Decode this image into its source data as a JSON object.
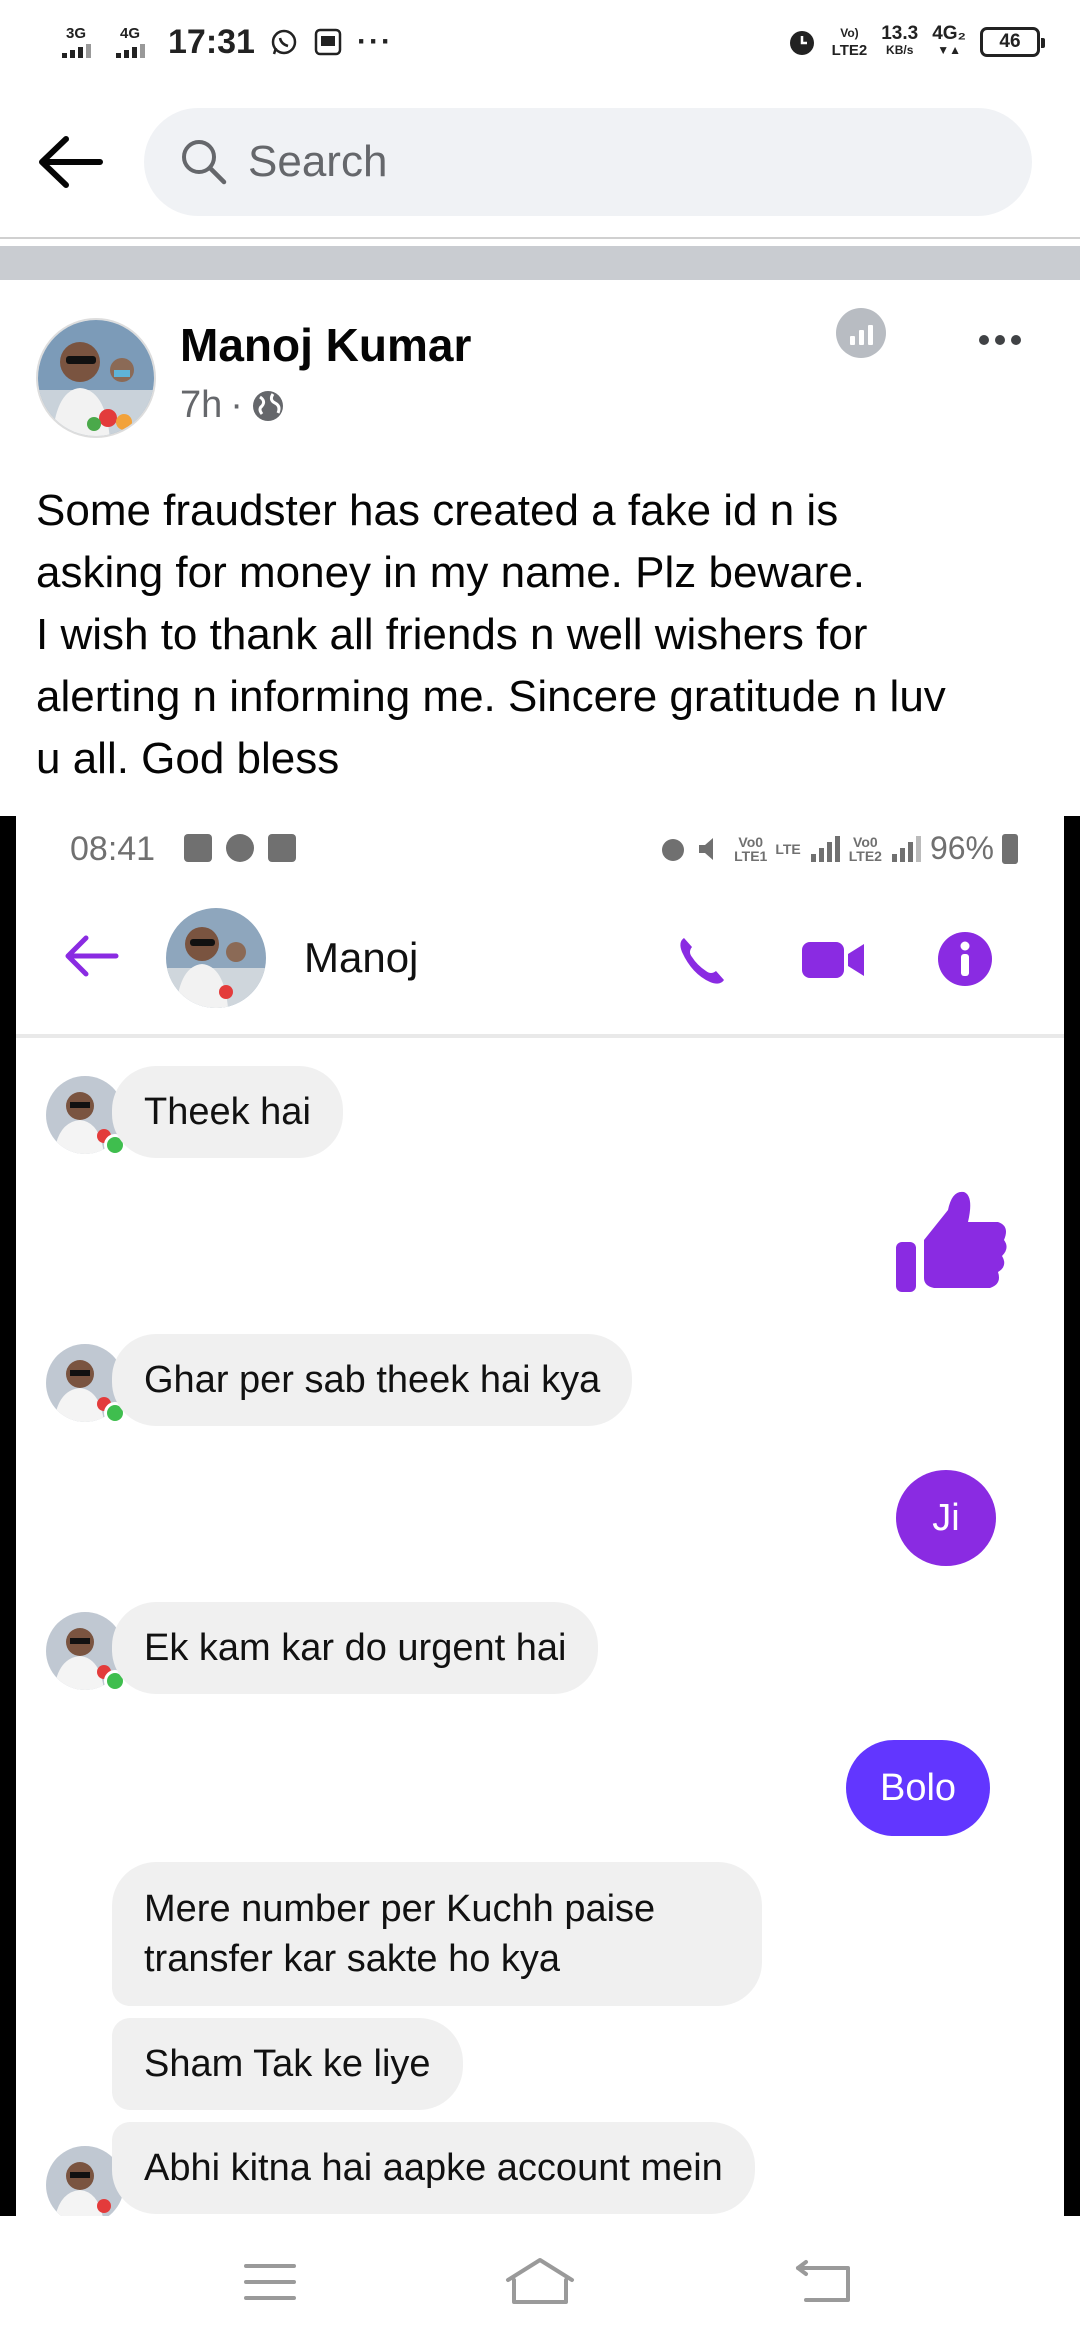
{
  "status_bar": {
    "network_1": "3G",
    "network_2": "4G",
    "time": "17:31",
    "more": "···",
    "volte": "Vo)",
    "volte_sub": "LTE2",
    "speed_value": "13.3",
    "speed_unit": "KB/s",
    "net_4g": "4G₂",
    "battery": "46"
  },
  "search": {
    "placeholder": "Search"
  },
  "post": {
    "author": "Manoj Kumar",
    "time": "7h",
    "separator": "·",
    "text_lines": [
      "Some fraudster has created a fake id n is",
      "asking for money in my name. Plz beware.",
      "I wish to thank all friends n well wishers for",
      "alerting n informing me. Sincere gratitude n luv",
      "u all. God bless"
    ]
  },
  "screenshot": {
    "time": "08:41",
    "battery": "96%",
    "volte_1": "Vo0",
    "volte_2": "LTE1",
    "lte": "LTE",
    "volte_3": "Vo0",
    "volte_4": "LTE2",
    "contact_name": "Manoj",
    "accent_color": "#7b2ff7",
    "sent_color_1": "#8a2be2",
    "sent_color_2": "#6236ff",
    "messages": {
      "m1": "Theek hai",
      "m2": "Ghar per sab theek hai kya",
      "m3": "Ji",
      "m4": "Ek kam kar do urgent hai",
      "m5": "Bolo",
      "m6_line1": "Mere number per Kuchh paise",
      "m6_line2": "transfer kar sakte ho kya",
      "m7": "Sham Tak ke liye",
      "m8": "Abhi kitna hai aapke account mein"
    }
  },
  "icons": [
    "back-arrow-icon",
    "search-icon",
    "globe-icon",
    "insights-icon",
    "more-icon",
    "phone-icon",
    "video-icon",
    "info-icon",
    "thumbs-up-icon",
    "menu-icon",
    "home-icon",
    "back-nav-icon"
  ]
}
